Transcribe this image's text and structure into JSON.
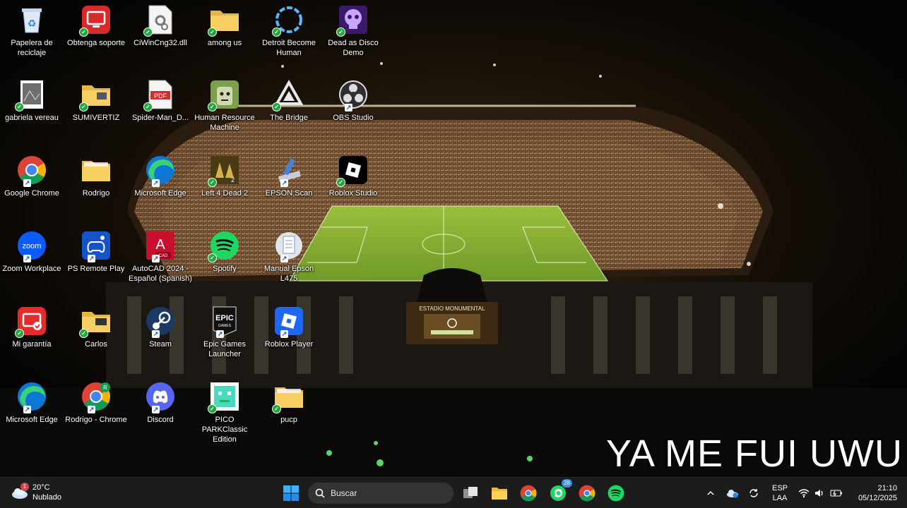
{
  "desktop": {
    "icons": [
      {
        "label": "Papelera de reciclaje",
        "icon": "recycle-bin-icon"
      },
      {
        "label": "Obtenga soporte",
        "icon": "get-support-icon"
      },
      {
        "label": "CiWinCng32.dll",
        "icon": "dll-file-icon"
      },
      {
        "label": "among us",
        "icon": "folder-icon"
      },
      {
        "label": "Detroit Become Human",
        "icon": "detroit-icon"
      },
      {
        "label": "Dead as Disco Demo",
        "icon": "dead-as-disco-icon"
      },
      {
        "label": "gabriela vereau",
        "icon": "image-file-icon"
      },
      {
        "label": "SUMIVERTIZ",
        "icon": "folder-icon"
      },
      {
        "label": "Spider-Man_D...",
        "icon": "pdf-file-icon"
      },
      {
        "label": "Human Resource Machine",
        "icon": "human-resource-machine-icon"
      },
      {
        "label": "The Bridge",
        "icon": "the-bridge-icon"
      },
      {
        "label": "OBS Studio",
        "icon": "obs-studio-icon"
      },
      {
        "label": "Google Chrome",
        "icon": "chrome-icon"
      },
      {
        "label": "Rodrigo",
        "icon": "folder-icon"
      },
      {
        "label": "Microsoft Edge",
        "icon": "edge-icon"
      },
      {
        "label": "Left 4 Dead 2",
        "icon": "left4dead2-icon"
      },
      {
        "label": "EPSON Scan",
        "icon": "epson-scan-icon"
      },
      {
        "label": "Roblox Studio",
        "icon": "roblox-studio-icon"
      },
      {
        "label": "Zoom Workplace",
        "icon": "zoom-icon"
      },
      {
        "label": "PS Remote Play",
        "icon": "ps-remote-play-icon"
      },
      {
        "label": "AutoCAD 2024 - Español (Spanish)",
        "icon": "autocad-icon"
      },
      {
        "label": "Spotify",
        "icon": "spotify-icon"
      },
      {
        "label": "Manual Epson L475",
        "icon": "manual-epson-icon"
      },
      {
        "label": "Mi garantía",
        "icon": "mi-garantia-icon"
      },
      {
        "label": "Carlos",
        "icon": "folder-icon"
      },
      {
        "label": "Steam",
        "icon": "steam-icon"
      },
      {
        "label": "Epic Games Launcher",
        "icon": "epic-games-icon"
      },
      {
        "label": "Roblox Player",
        "icon": "roblox-player-icon"
      },
      {
        "label": "Microsoft Edge",
        "icon": "edge-icon"
      },
      {
        "label": "Rodrigo - Chrome",
        "icon": "chrome-profile-icon"
      },
      {
        "label": "Discord",
        "icon": "discord-icon"
      },
      {
        "label": "PICO PARKClassic Edition",
        "icon": "pico-park-icon"
      },
      {
        "label": "pucp",
        "icon": "folder-icon"
      }
    ]
  },
  "overlay": {
    "caption": "YA ME FUI UWU"
  },
  "wallpaper": {
    "sign_text": "ESTADIO MONUMENTAL"
  },
  "taskbar": {
    "weather": {
      "temp": "20°C",
      "condition": "Nublado",
      "alert_count": "1"
    },
    "search": {
      "placeholder": "Buscar"
    },
    "whatsapp_badge": "28",
    "language": {
      "line1": "ESP",
      "line2": "LAA"
    },
    "clock": {
      "time": "21:10",
      "date": "05/12/2025"
    }
  },
  "colors": {
    "taskbar_bg": "#1c1c1c",
    "sync_green": "#1faa3b",
    "accent_blue": "#0078d4"
  }
}
